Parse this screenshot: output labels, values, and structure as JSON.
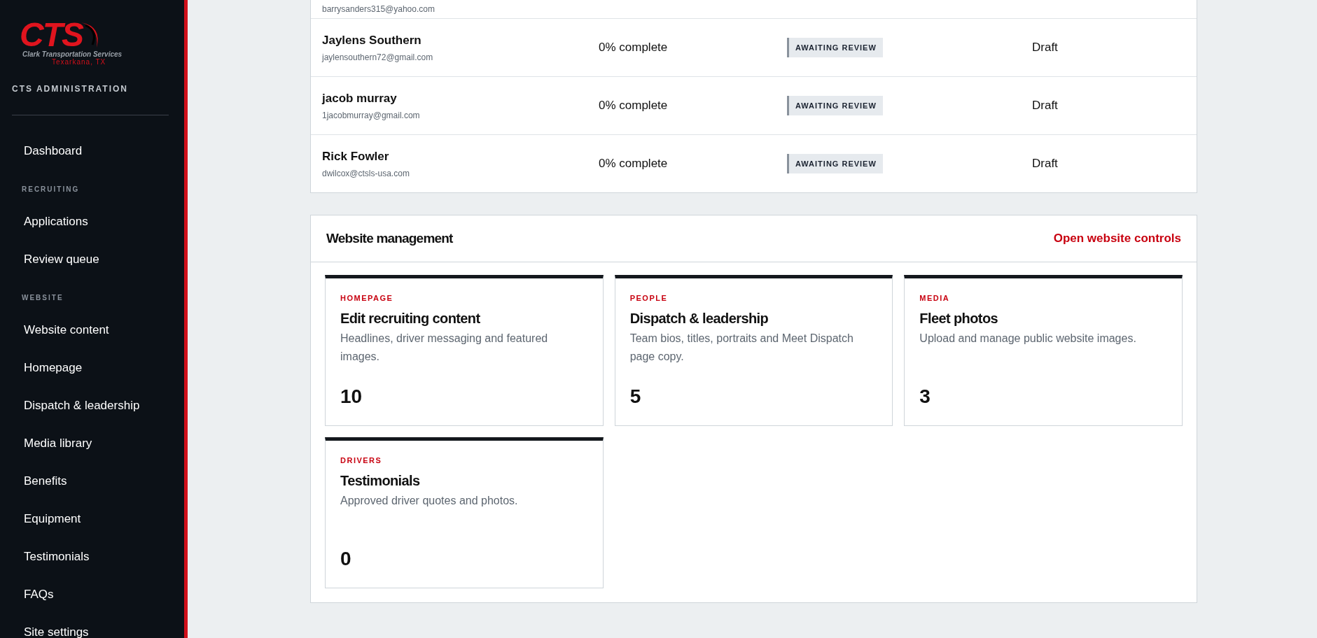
{
  "sidebar": {
    "logo": {
      "mark": "CTS",
      "company": "Clark Transportation Services",
      "location": "Texarkana, TX"
    },
    "title": "CTS ADMINISTRATION",
    "sections": [
      {
        "items": [
          {
            "label": "Dashboard",
            "selected": false
          }
        ]
      },
      {
        "heading": "RECRUITING",
        "items": [
          {
            "label": "Applications",
            "selected": false
          },
          {
            "label": "Review queue",
            "selected": false
          }
        ]
      },
      {
        "heading": "WEBSITE",
        "items": [
          {
            "label": "Website content",
            "selected": false
          },
          {
            "label": "Homepage",
            "selected": false
          },
          {
            "label": "Dispatch & leadership",
            "selected": false
          },
          {
            "label": "Media library",
            "selected": false
          },
          {
            "label": "Benefits",
            "selected": false
          },
          {
            "label": "Equipment",
            "selected": false
          },
          {
            "label": "Testimonials",
            "selected": false
          },
          {
            "label": "FAQs",
            "selected": false
          },
          {
            "label": "Site settings",
            "selected": false
          }
        ]
      }
    ]
  },
  "applications": {
    "partial_row_email": "barrysanders315@yahoo.com",
    "rows": [
      {
        "name": "Jaylens Southern",
        "email": "jaylensouthern72@gmail.com",
        "progress": "0% complete",
        "status": "AWAITING REVIEW",
        "stage": "Draft"
      },
      {
        "name": "jacob murray",
        "email": "1jacobmurray@gmail.com",
        "progress": "0% complete",
        "status": "AWAITING REVIEW",
        "stage": "Draft"
      },
      {
        "name": "Rick Fowler",
        "email": "dwilcox@ctsls-usa.com",
        "progress": "0% complete",
        "status": "AWAITING REVIEW",
        "stage": "Draft"
      }
    ]
  },
  "website_management": {
    "title": "Website management",
    "link": "Open website controls",
    "cards": [
      {
        "category": "HOMEPAGE",
        "title": "Edit recruiting content",
        "description": "Headlines, driver messaging and featured images.",
        "count": "10"
      },
      {
        "category": "PEOPLE",
        "title": "Dispatch & leadership",
        "description": "Team bios, titles, portraits and Meet Dispatch page copy.",
        "count": "5"
      },
      {
        "category": "MEDIA",
        "title": "Fleet photos",
        "description": "Upload and manage public website images.",
        "count": "3"
      },
      {
        "category": "DRIVERS",
        "title": "Testimonials",
        "description": "Approved driver quotes and photos.",
        "count": "0"
      }
    ]
  }
}
